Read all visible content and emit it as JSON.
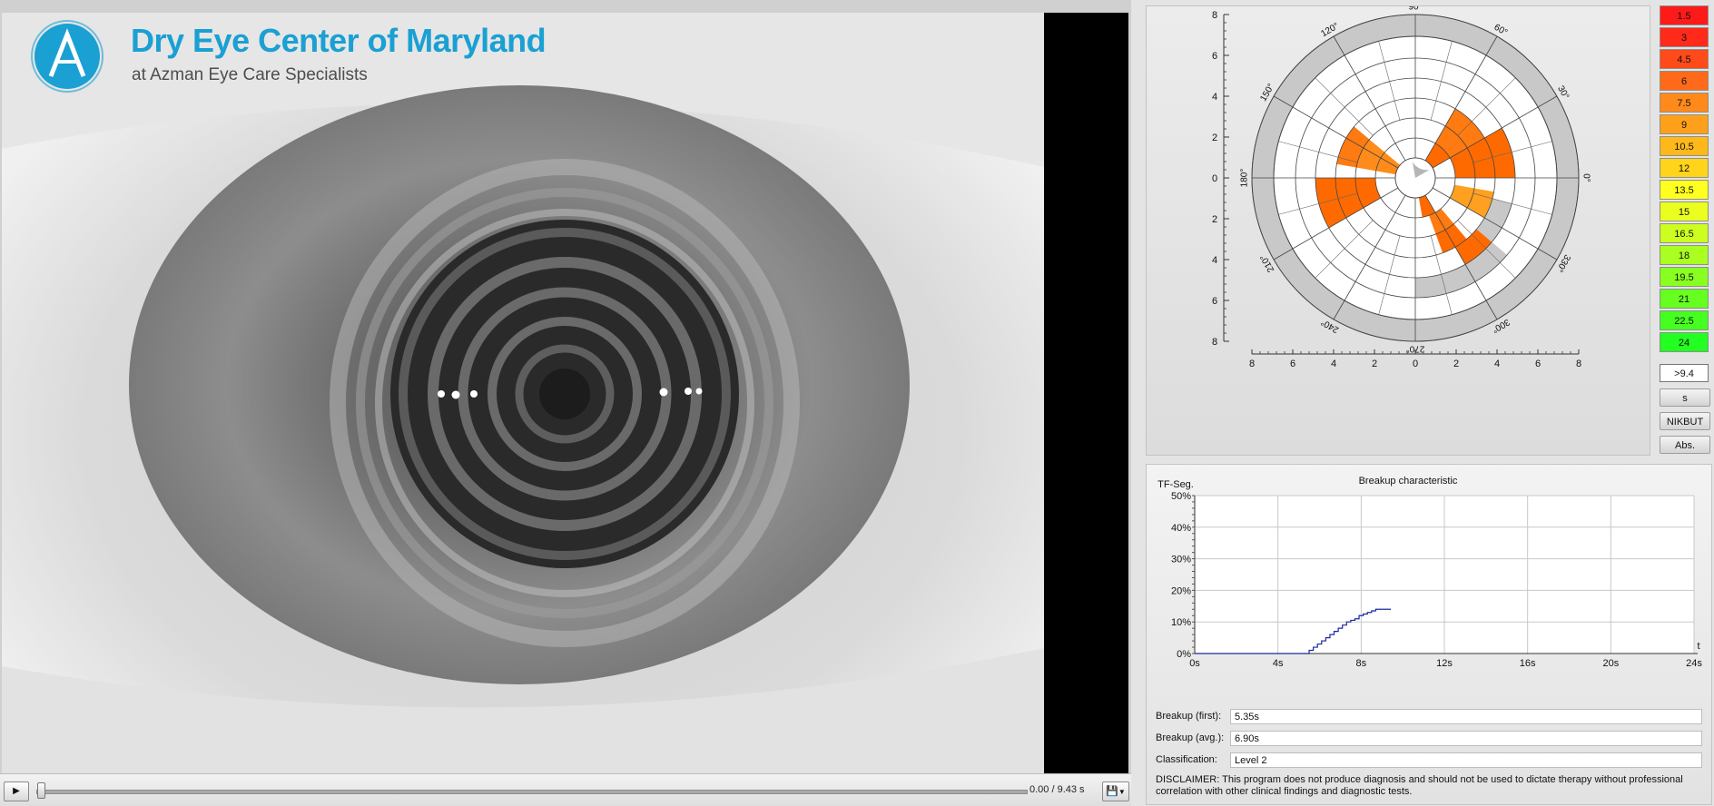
{
  "logo": {
    "title": "Dry Eye Center of Maryland",
    "subtitle": "at Azman Eye Care Specialists",
    "brand_color": "#1aa0d3"
  },
  "player": {
    "play_icon": "play-icon",
    "time": "0.00 / 9.43 s",
    "save_icon": "floppy-disk-icon",
    "dropdown_icon": "chevron-down-icon",
    "position": 0
  },
  "polar": {
    "angle_labels": [
      "90°",
      "60°",
      "30°",
      "0°",
      "330°",
      "300°",
      "270°",
      "240°",
      "210°",
      "180°",
      "150°",
      "120°"
    ],
    "left_axis_ticks": [
      "8",
      "6",
      "4",
      "2",
      "0",
      "2",
      "4",
      "6",
      "8"
    ],
    "bottom_axis_ticks": [
      "8",
      "6",
      "4",
      "2",
      "0",
      "2",
      "4",
      "6",
      "8"
    ],
    "sectors": [
      {
        "from": 0,
        "to": 30,
        "ring": 2,
        "color": "#ff6a00"
      },
      {
        "from": 0,
        "to": 30,
        "ring": 3,
        "color": "#ff6a00"
      },
      {
        "from": 0,
        "to": 30,
        "ring": 4,
        "color": "#ff6a00"
      },
      {
        "from": 30,
        "to": 60,
        "ring": 1,
        "color": "#ff6a00"
      },
      {
        "from": 30,
        "to": 60,
        "ring": 2,
        "color": "#ff7a10"
      },
      {
        "from": 30,
        "to": 60,
        "ring": 3,
        "color": "#ff7a10"
      },
      {
        "from": 140,
        "to": 170,
        "ring": 1,
        "color": "#ff8c1a"
      },
      {
        "from": 140,
        "to": 170,
        "ring": 2,
        "color": "#ff8c1a"
      },
      {
        "from": 140,
        "to": 170,
        "ring": 3,
        "color": "#ff7a10"
      },
      {
        "from": 180,
        "to": 210,
        "ring": 2,
        "color": "#ff6a00"
      },
      {
        "from": 180,
        "to": 210,
        "ring": 3,
        "color": "#ff6a00"
      },
      {
        "from": 180,
        "to": 210,
        "ring": 4,
        "color": "#ff6a00"
      },
      {
        "from": 280,
        "to": 300,
        "ring": 1,
        "color": "#ff6a00"
      },
      {
        "from": 290,
        "to": 310,
        "ring": 2,
        "color": "#ff7a10"
      },
      {
        "from": 290,
        "to": 310,
        "ring": 3,
        "color": "#ff6a00"
      },
      {
        "from": 300,
        "to": 320,
        "ring": 4,
        "color": "#ff6a00"
      },
      {
        "from": 330,
        "to": 350,
        "ring": 2,
        "color": "#ffa020"
      },
      {
        "from": 330,
        "to": 350,
        "ring": 3,
        "color": "#ffa020"
      }
    ],
    "gray_sectors": [
      {
        "from": 270,
        "to": 320,
        "ring": 5,
        "color": "#c8c8c8"
      },
      {
        "from": 315,
        "to": 345,
        "ring": 4,
        "color": "#c8c8c8"
      }
    ]
  },
  "legend": {
    "items": [
      {
        "label": "1.5",
        "color": "#ff1a1a"
      },
      {
        "label": "3",
        "color": "#ff2a1a"
      },
      {
        "label": "4.5",
        "color": "#ff4a1a"
      },
      {
        "label": "6",
        "color": "#ff6a1a"
      },
      {
        "label": "7.5",
        "color": "#ff8a1a"
      },
      {
        "label": "9",
        "color": "#ffa01a"
      },
      {
        "label": "10.5",
        "color": "#ffb81a"
      },
      {
        "label": "12",
        "color": "#ffd41a"
      },
      {
        "label": "13.5",
        "color": "#ffff20"
      },
      {
        "label": "15",
        "color": "#eaff20"
      },
      {
        "label": "16.5",
        "color": "#ccff20"
      },
      {
        "label": "18",
        "color": "#aaff20"
      },
      {
        "label": "19.5",
        "color": "#88ff20"
      },
      {
        "label": "21",
        "color": "#66ff20"
      },
      {
        "label": "22.5",
        "color": "#44ff20"
      },
      {
        "label": "24",
        "color": "#22ff20"
      }
    ],
    "threshold": ">9.4",
    "buttons": [
      "s",
      "NIKBUT",
      "Abs."
    ]
  },
  "breakup": {
    "first_label": "Breakup (first):",
    "first_value": "5.35s",
    "avg_label": "Breakup (avg.):",
    "avg_value": "6.90s",
    "class_label": "Classification:",
    "class_value": "Level 2",
    "disclaimer": "DISCLAIMER: This program does not produce diagnosis and should not be used to dictate therapy without professional correlation with other clinical findings and diagnostic tests."
  },
  "chart_data": {
    "type": "line",
    "title": "Breakup characteristic",
    "ylabel": "TF-Seg.",
    "xlabel": "t",
    "xlim": [
      0,
      24
    ],
    "ylim": [
      0,
      50
    ],
    "x_ticks": [
      "0s",
      "4s",
      "8s",
      "12s",
      "16s",
      "20s",
      "24s"
    ],
    "y_ticks": [
      "0%",
      "10%",
      "20%",
      "30%",
      "40%",
      "50%"
    ],
    "grid": true,
    "line_color": "#1a2a9a",
    "series": [
      {
        "x": [
          0,
          5.35,
          5.5,
          5.7,
          5.9,
          6.1,
          6.3,
          6.5,
          6.7,
          6.9,
          7.1,
          7.3,
          7.5,
          7.7,
          7.9,
          8.1,
          8.3,
          8.5,
          8.7,
          9.0,
          9.43
        ],
        "values": [
          0,
          0,
          1,
          2,
          3,
          4,
          5,
          6,
          7,
          8,
          9,
          10,
          10.5,
          11,
          12,
          12.5,
          13,
          13.5,
          14,
          14,
          14
        ]
      }
    ]
  }
}
